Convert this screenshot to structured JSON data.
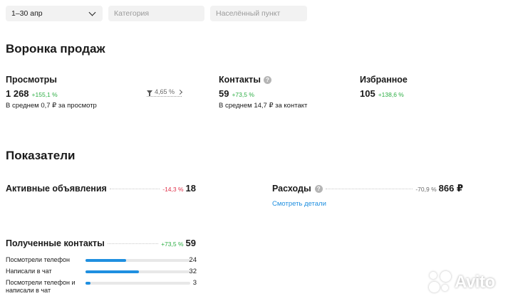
{
  "filters": {
    "date_value": "1–30 апр",
    "category_placeholder": "Категория",
    "location_placeholder": "Населённый пункт"
  },
  "funnel": {
    "title": "Воронка продаж",
    "views": {
      "label": "Просмотры",
      "value": "1 268",
      "change": "+155,1 %",
      "sub": "В среднем 0,7 ₽ за просмотр"
    },
    "conversion": "4,65 %",
    "contacts": {
      "label": "Контакты",
      "value": "59",
      "change": "+73,5 %",
      "sub": "В среднем 14,7 ₽ за контакт"
    },
    "favorites": {
      "label": "Избранное",
      "value": "105",
      "change": "+138,6 %"
    }
  },
  "metrics": {
    "title": "Показатели",
    "active_ads": {
      "label": "Активные объявления",
      "change": "-14,3 %",
      "value": "18"
    },
    "expenses": {
      "label": "Расходы",
      "change": "-70,9 %",
      "value": "866 ₽",
      "link": "Смотреть детали"
    },
    "received_contacts": {
      "label": "Полученные контакты",
      "change": "+73,5 %",
      "value": "59",
      "breakdown": [
        {
          "label": "Посмотрели телефон",
          "value": "24",
          "fraction": 0.39
        },
        {
          "label": "Написали в чат",
          "value": "32",
          "fraction": 0.51
        },
        {
          "label": "Посмотрели телефон и написали в чат",
          "value": "3",
          "fraction": 0.05
        }
      ]
    }
  },
  "watermark": {
    "text": "Avito"
  },
  "colors": {
    "accent": "#1f8fe0",
    "positive": "#2eae45",
    "negative": "#e0304a"
  }
}
